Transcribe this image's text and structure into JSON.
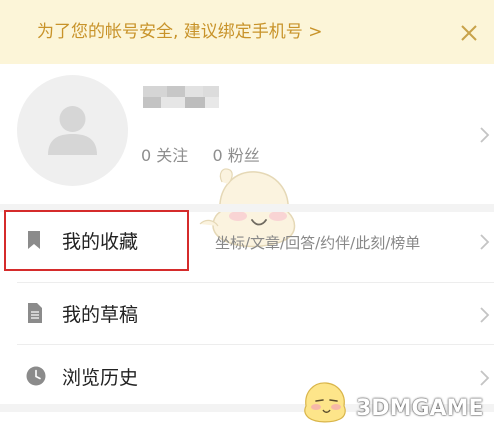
{
  "banner": {
    "text": "为了您的帐号安全, 建议绑定手机号 >",
    "close_icon": "close-icon",
    "background": "#fcf5d8",
    "text_color": "#c8932a"
  },
  "profile": {
    "avatar_icon": "user-avatar-icon",
    "follow_label": "0 关注",
    "fans_label": "0 粉丝"
  },
  "menu": {
    "items": [
      {
        "label": "我的收藏",
        "sub": "坐标/文章/回答/约伴/此刻/榜单",
        "icon": "bookmark-icon"
      },
      {
        "label": "我的草稿",
        "sub": "",
        "icon": "document-icon"
      },
      {
        "label": "浏览历史",
        "sub": "",
        "icon": "clock-icon"
      }
    ]
  },
  "highlight_color": "#d52b2b",
  "watermark": "3DMGAME"
}
